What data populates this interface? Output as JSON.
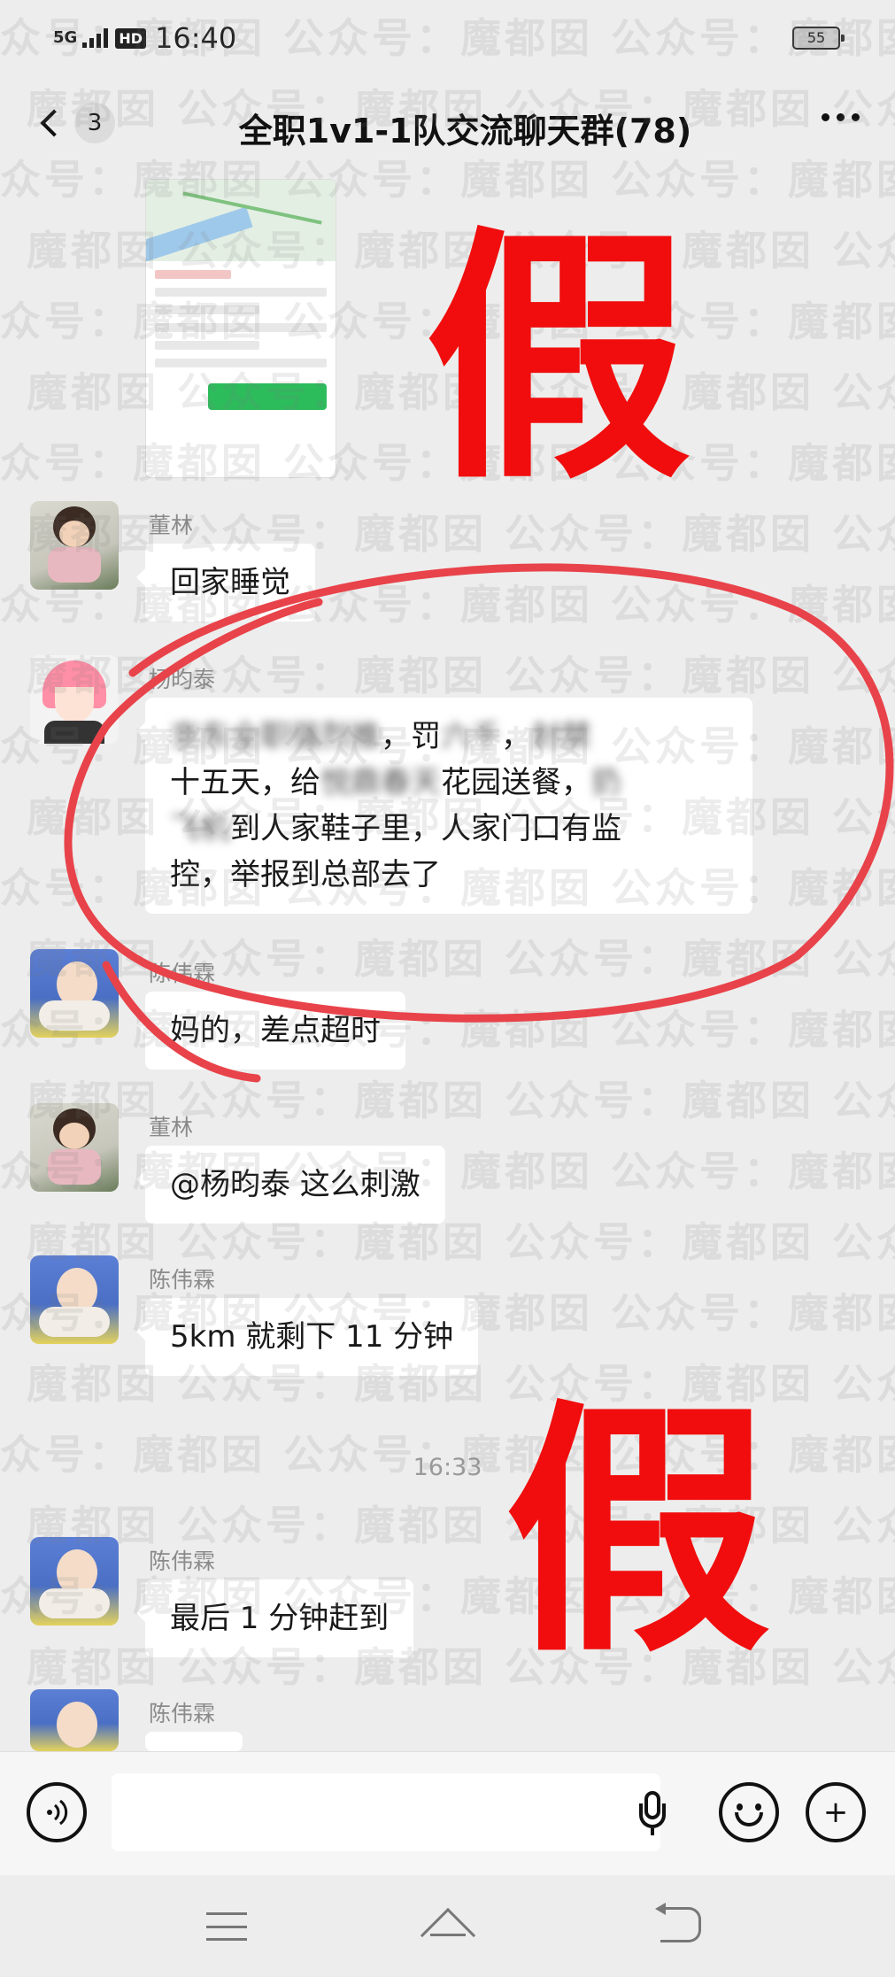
{
  "status_bar": {
    "network": "5G",
    "hd": "HD",
    "time": "16:40",
    "battery": "55"
  },
  "nav": {
    "unread_count": "3",
    "title": "全职1v1-1队交流聊天群(78)"
  },
  "image_message": {
    "description_hidden": "",
    "company_name": "和沣电子科技有限公司",
    "goods_label": "货品",
    "goods_value": "文件 小于5公斤",
    "photo_label": "已拍照片",
    "confirm_button": "确认取件送达"
  },
  "messages": [
    {
      "sender": "董林",
      "text": "回家睡觉"
    },
    {
      "sender": "杨昀泰",
      "line1_blur_a": "京东全职强烈推",
      "line1_mid": "，罚",
      "line1_blur_b": "六千",
      "line1_end": "，",
      "line1_blur_c": "封禁",
      "line2_start": "十五天，给",
      "line2_blur": "悦鼎春天",
      "line2_end": "花园送餐，",
      "line2_blur_end": "扔",
      "line3_blur": "飞机",
      "line3_end": "到人家鞋子里，人家门口有监",
      "line4": "控，举报到总部去了"
    },
    {
      "sender": "陈伟霖",
      "text": "妈的，差点超时"
    },
    {
      "sender": "董林",
      "text": "@杨昀泰  这么刺激"
    },
    {
      "sender": "陈伟霖",
      "text": "5km 就剩下 11 分钟"
    },
    {
      "timestamp": "16:33"
    },
    {
      "sender": "陈伟霖",
      "text": "最后 1 分钟赶到"
    },
    {
      "sender": "陈伟霖",
      "text": ""
    }
  ],
  "overlay": {
    "fake_stamp_1": "假",
    "fake_stamp_2": "假",
    "watermark_text": "众号：魔都囡 公众号：魔都囡 公众号：魔都囡 公众号",
    "stamp_color": "#f10d0d",
    "circle_color": "#e8434a"
  },
  "input_bar": {
    "voice_icon": "voice-toggle-icon",
    "emoji_icon": "emoji-icon",
    "plus_icon": "plus-icon",
    "plus_glyph": "+"
  }
}
